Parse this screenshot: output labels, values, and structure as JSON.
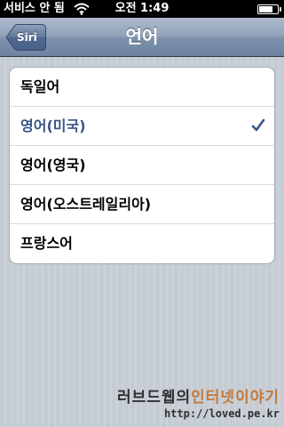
{
  "status_bar": {
    "carrier": "서비스 안 됨",
    "time": "오전 1:49",
    "wifi_icon": "wifi-icon",
    "battery_icon": "battery-icon"
  },
  "nav_bar": {
    "title": "언어",
    "back_label": "Siri"
  },
  "languages": {
    "items": [
      {
        "label": "독일어",
        "selected": false
      },
      {
        "label": "영어(미국)",
        "selected": true
      },
      {
        "label": "영어(영국)",
        "selected": false
      },
      {
        "label": "영어(오스트레일리아)",
        "selected": false
      },
      {
        "label": "프랑스어",
        "selected": false
      }
    ],
    "checkmark_icon": "checkmark-icon",
    "selected_color": "#385487"
  },
  "watermark": {
    "title_part1": "러브드웹의",
    "title_part2": "인터넷이야기",
    "url": "http://loved.pe.kr"
  }
}
